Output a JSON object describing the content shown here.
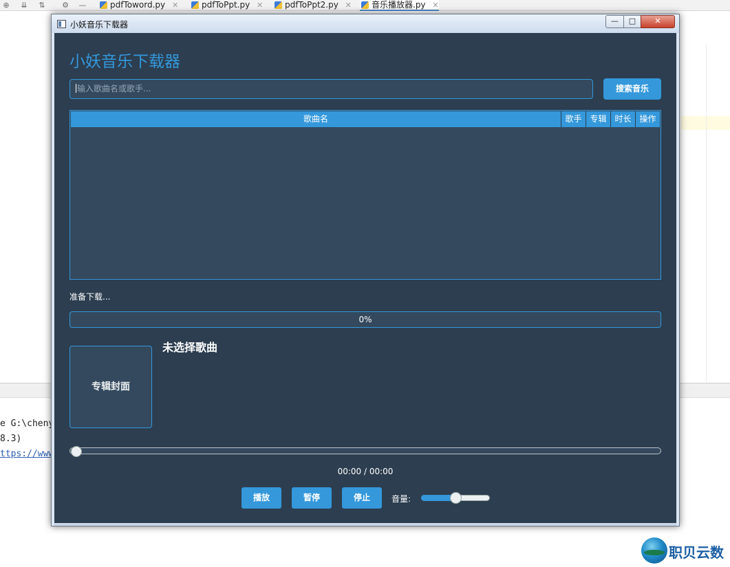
{
  "ide": {
    "tabs": [
      {
        "label": "pdfToword.py"
      },
      {
        "label": "pdfToPpt.py"
      },
      {
        "label": "pdfToPpt2.py"
      },
      {
        "label": "音乐播放器.py"
      }
    ],
    "tab_close_glyph": "✕",
    "console_lines": [
      "e G:\\cheny",
      "8.3)",
      "ttps://www"
    ]
  },
  "window": {
    "title": "小妖音乐下载器",
    "buttons": {
      "minimize": "—",
      "maximize": "□",
      "close": "✕"
    }
  },
  "app": {
    "heading": "小妖音乐下载器",
    "search": {
      "placeholder": "输入歌曲名或歌手...",
      "button_label": "搜索音乐"
    },
    "table": {
      "columns": [
        "歌曲名",
        "歌手",
        "专辑",
        "时长",
        "操作"
      ],
      "rows": []
    },
    "status_text": "准备下载...",
    "progress": {
      "value": 0,
      "label": "0%"
    },
    "cover_label": "专辑封面",
    "now_playing_title": "未选择歌曲",
    "seek": {
      "position": 0
    },
    "time_display": "00:00 / 00:00",
    "controls": {
      "play_label": "播放",
      "pause_label": "暂停",
      "stop_label": "停止"
    },
    "volume": {
      "label": "音量:",
      "value": 50
    }
  },
  "watermark": {
    "text": "职贝云数"
  },
  "colors": {
    "background": "#2c3e50",
    "panel": "#34495e",
    "accent": "#3498db",
    "text": "#ffffff"
  }
}
